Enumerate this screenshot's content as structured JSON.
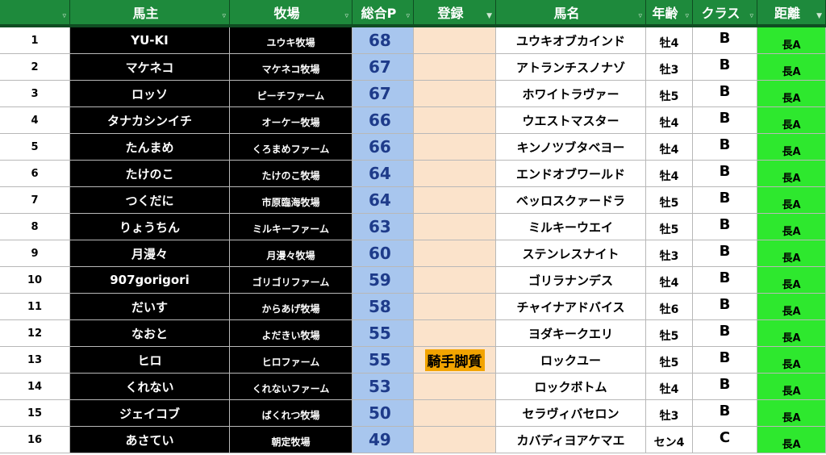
{
  "headers": [
    {
      "label": ""
    },
    {
      "label": "馬主"
    },
    {
      "label": "牧場"
    },
    {
      "label": "総合P"
    },
    {
      "label": "登録"
    },
    {
      "label": "馬名"
    },
    {
      "label": "年齢"
    },
    {
      "label": "クラス"
    },
    {
      "label": "距離"
    }
  ],
  "filter_icons": [
    "▿",
    "▿",
    "▿",
    "▿",
    "▼",
    "▿",
    "▿",
    "▿",
    "▼"
  ],
  "rows": [
    {
      "no": "1",
      "owner": "YU-KI",
      "farm": "ユウキ牧場",
      "points": "68",
      "reg": "",
      "horse": "ユウキオブカインド",
      "age": "牡4",
      "cls": "B",
      "dist": "長A"
    },
    {
      "no": "2",
      "owner": "マケネコ",
      "farm": "マケネコ牧場",
      "points": "67",
      "reg": "",
      "horse": "アトランチスノナゾ",
      "age": "牡3",
      "cls": "B",
      "dist": "長A"
    },
    {
      "no": "3",
      "owner": "ロッソ",
      "farm": "ピーチファーム",
      "points": "67",
      "reg": "",
      "horse": "ホワイトラヴァー",
      "age": "牡5",
      "cls": "B",
      "dist": "長A"
    },
    {
      "no": "4",
      "owner": "タナカシンイチ",
      "farm": "オーケー牧場",
      "points": "66",
      "reg": "",
      "horse": "ウエストマスター",
      "age": "牡4",
      "cls": "B",
      "dist": "長A"
    },
    {
      "no": "5",
      "owner": "たんまめ",
      "farm": "くろまめファーム",
      "points": "66",
      "reg": "",
      "horse": "キンノツブタベヨー",
      "age": "牡4",
      "cls": "B",
      "dist": "長A"
    },
    {
      "no": "6",
      "owner": "たけのこ",
      "farm": "たけのこ牧場",
      "points": "64",
      "reg": "",
      "horse": "エンドオブワールド",
      "age": "牡4",
      "cls": "B",
      "dist": "長A"
    },
    {
      "no": "7",
      "owner": "つくだに",
      "farm": "市原臨海牧場",
      "points": "64",
      "reg": "",
      "horse": "ベッロスクァードラ",
      "age": "牡5",
      "cls": "B",
      "dist": "長A"
    },
    {
      "no": "8",
      "owner": "りょうちん",
      "farm": "ミルキーファーム",
      "points": "63",
      "reg": "",
      "horse": "ミルキーウエイ",
      "age": "牡5",
      "cls": "B",
      "dist": "長A"
    },
    {
      "no": "9",
      "owner": "月漫々",
      "farm": "月漫々牧場",
      "points": "60",
      "reg": "",
      "horse": "ステンレスナイト",
      "age": "牡3",
      "cls": "B",
      "dist": "長A"
    },
    {
      "no": "10",
      "owner": "907gorigori",
      "farm": "ゴリゴリファーム",
      "points": "59",
      "reg": "",
      "horse": "ゴリラナンデス",
      "age": "牡4",
      "cls": "B",
      "dist": "長A"
    },
    {
      "no": "11",
      "owner": "だいす",
      "farm": "からあげ牧場",
      "points": "58",
      "reg": "",
      "horse": "チャイナアドバイス",
      "age": "牡6",
      "cls": "B",
      "dist": "長A"
    },
    {
      "no": "12",
      "owner": "なおと",
      "farm": "よだきい牧場",
      "points": "55",
      "reg": "",
      "horse": "ヨダキークエリ",
      "age": "牡5",
      "cls": "B",
      "dist": "長A"
    },
    {
      "no": "13",
      "owner": "ヒロ",
      "farm": "ヒロファーム",
      "points": "55",
      "reg": "騎手脚質",
      "horse": "ロックユー",
      "age": "牡5",
      "cls": "B",
      "dist": "長A"
    },
    {
      "no": "14",
      "owner": "くれない",
      "farm": "くれないファーム",
      "points": "53",
      "reg": "",
      "horse": "ロックボトム",
      "age": "牡4",
      "cls": "B",
      "dist": "長A"
    },
    {
      "no": "15",
      "owner": "ジェイコブ",
      "farm": "ばくれつ牧場",
      "points": "50",
      "reg": "",
      "horse": "セラヴィバセロン",
      "age": "牡3",
      "cls": "B",
      "dist": "長A"
    },
    {
      "no": "16",
      "owner": "あさてい",
      "farm": "朝定牧場",
      "points": "49",
      "reg": "",
      "horse": "カバディヨアケマエ",
      "age": "セン4",
      "cls": "C",
      "dist": "長A"
    }
  ],
  "colors": {
    "header_bg": "#1e8a3c",
    "owner_bg": "#000000",
    "points_bg": "#a8c6ee",
    "reg_bg": "#fbe3cb",
    "reg_tag_bg": "#f2a400",
    "dist_bg": "#2ee82e"
  }
}
